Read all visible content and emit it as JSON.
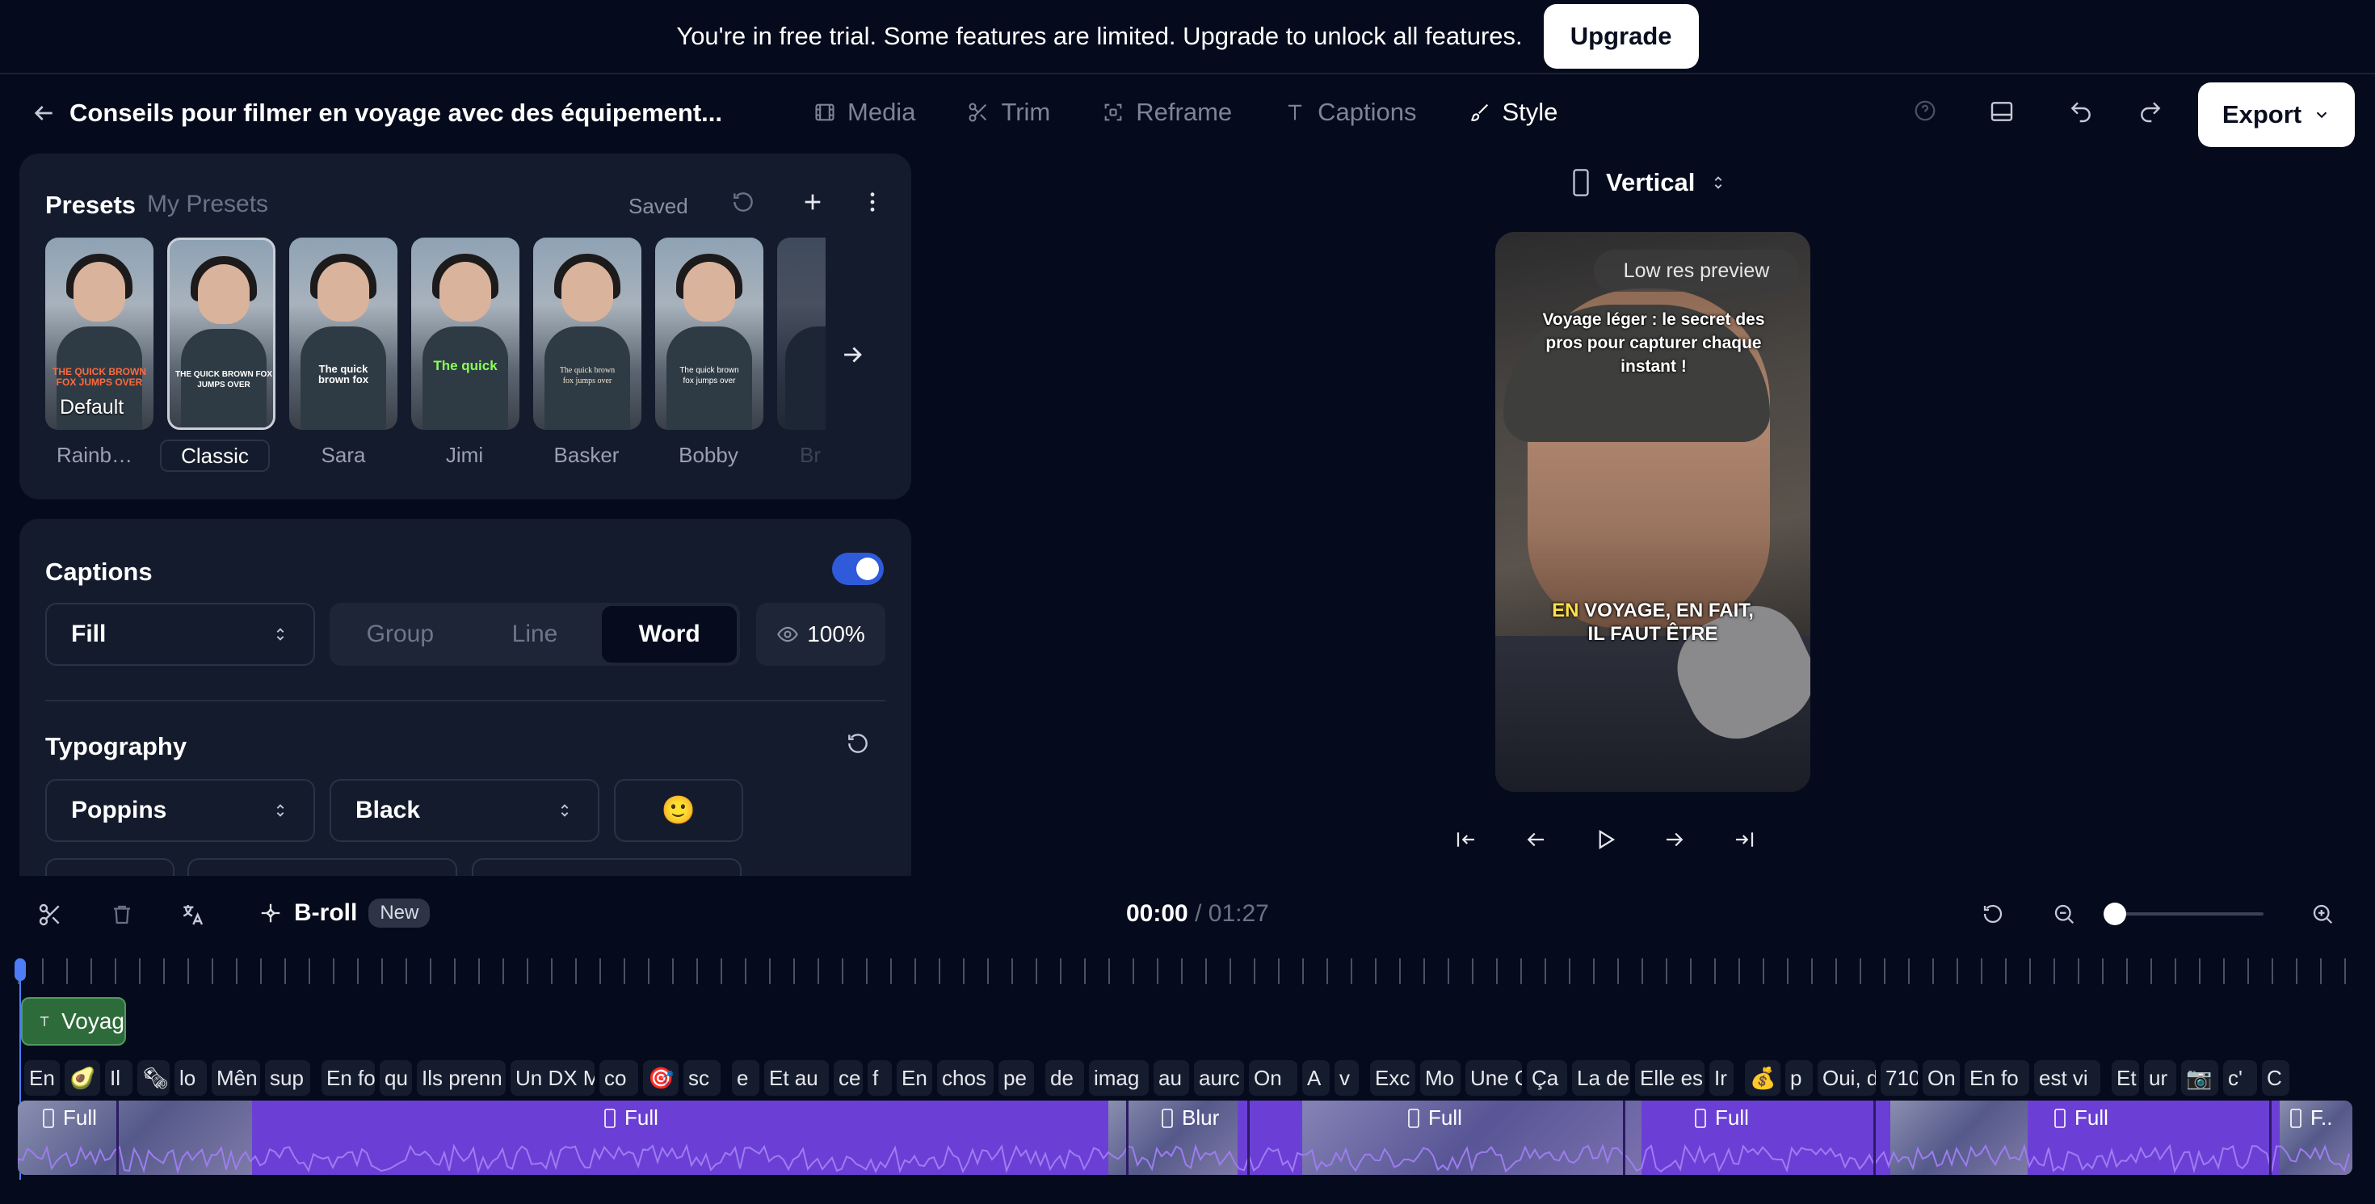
{
  "banner": {
    "message": "You're in free trial. Some features are limited. Upgrade to unlock all features.",
    "upgrade": "Upgrade"
  },
  "header": {
    "title": "Conseils pour filmer en voyage avec des équipement...",
    "tabs": [
      {
        "label": "Media",
        "icon": "film-icon"
      },
      {
        "label": "Trim",
        "icon": "scissors-icon"
      },
      {
        "label": "Reframe",
        "icon": "reframe-icon"
      },
      {
        "label": "Captions",
        "icon": "text-icon"
      },
      {
        "label": "Style",
        "icon": "brush-icon"
      }
    ],
    "export": "Export"
  },
  "presets": {
    "tab_presets": "Presets",
    "tab_my": "My Presets",
    "saved": "Saved",
    "items": [
      {
        "name": "Rainb…",
        "badge": "Default",
        "caption": "THE QUICK BROWN FOX JUMPS OVER"
      },
      {
        "name": "Classic",
        "caption": "THE QUICK BROWN FOX JUMPS OVER"
      },
      {
        "name": "Sara",
        "caption": "The quick brown fox"
      },
      {
        "name": "Jimi",
        "caption": "The quick"
      },
      {
        "name": "Basker",
        "caption": "The quick brown fox jumps over"
      },
      {
        "name": "Bobby",
        "caption": "The quick brown fox jumps over"
      },
      {
        "name": "Br",
        "caption": ""
      }
    ]
  },
  "captions": {
    "title": "Captions",
    "fill": "Fill",
    "modes": [
      "Group",
      "Line",
      "Word"
    ],
    "opacity": "100%"
  },
  "typography": {
    "title": "Typography",
    "font": "Poppins",
    "weight": "Black",
    "emoji": "🙂"
  },
  "preview": {
    "orientation": "Vertical",
    "badge": "Low res preview",
    "title_text": "Voyage léger : le secret des pros pour capturer chaque instant !",
    "caption_highlight": "EN",
    "caption_rest": " VOYAGE, EN FAIT, IL FAUT ÊTRE"
  },
  "toolbar": {
    "broll": "B-roll",
    "new_badge": "New",
    "time_current": "00:00",
    "time_sep": "/",
    "time_total": "01:27"
  },
  "timeline": {
    "text_clip": "Voyag",
    "caption_chips": [
      "En v",
      "🥑",
      "Il",
      "🗞",
      "lo",
      "Mên",
      "sup",
      "En fo",
      "qu",
      "Ils prenn",
      "Un DX M",
      "co",
      "🎯",
      "sc",
      "e",
      "Et au",
      "ce",
      "f",
      "En",
      "chos",
      "pe",
      "de",
      "imag",
      "au",
      "aurc",
      "On",
      "A",
      "v",
      "Exc",
      "Mo",
      "Une G",
      "Ça",
      "La de",
      "Elle es",
      "Ir",
      "💰",
      "p",
      "Oui, d",
      "710",
      "On",
      "En fo",
      "est vi",
      "Et",
      "ur",
      "📷",
      "c'",
      "C"
    ],
    "clips": [
      {
        "label": "Full",
        "icon": "phone-icon"
      },
      {
        "label": "Full",
        "icon": "phone-icon"
      },
      {
        "label": "Blur",
        "icon": "phone-icon"
      },
      {
        "label": "Full",
        "icon": "phone-icon"
      },
      {
        "label": "Full",
        "icon": "phone-icon"
      },
      {
        "label": "Full",
        "icon": "phone-icon"
      },
      {
        "label": "F..",
        "icon": "phone-icon"
      }
    ]
  },
  "colors": {
    "bg": "#050b1c",
    "panel": "#141b2c",
    "accent": "#2f5bdb",
    "clip": "#6b3fd6",
    "highlight": "#ffe14a"
  }
}
